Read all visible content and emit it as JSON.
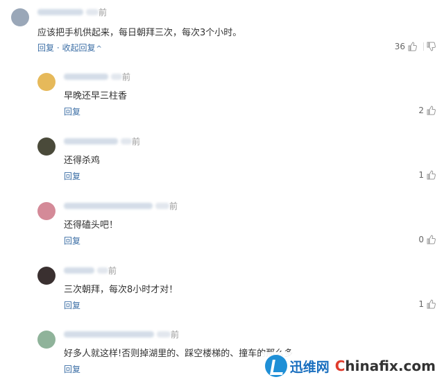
{
  "comments": [
    {
      "time_suffix": "前",
      "text": "应该把手机供起来，每日朝拜三次，每次3个小时。",
      "reply_label": "回复",
      "collapse_label": "收起回复",
      "likes": "36",
      "avatar_color": "#9aa7b8"
    },
    {
      "time_suffix": "前",
      "text": "早晚还早三柱香",
      "reply_label": "回复",
      "likes": "2",
      "avatar_color": "#e6b95a"
    },
    {
      "time_suffix": "前",
      "text": "还得杀鸡",
      "reply_label": "回复",
      "likes": "1",
      "avatar_color": "#4a4a3a"
    },
    {
      "time_suffix": "前",
      "text": "还得磕头吧！",
      "reply_label": "回复",
      "likes": "0",
      "avatar_color": "#d48a98"
    },
    {
      "time_suffix": "前",
      "text": "三次朝拜，每次8小时才对！",
      "reply_label": "回复",
      "likes": "1",
      "avatar_color": "#3a3030"
    },
    {
      "time_suffix": "前",
      "text": "好多人就这样!否则掉湖里的、踩空楼梯的、撞车的那么多",
      "reply_label": "回复",
      "likes": "",
      "avatar_color": "#8fb39a"
    }
  ],
  "watermark": {
    "brand": "迅维网",
    "site_prefix": "C",
    "site_rest": "hinafix.com"
  }
}
